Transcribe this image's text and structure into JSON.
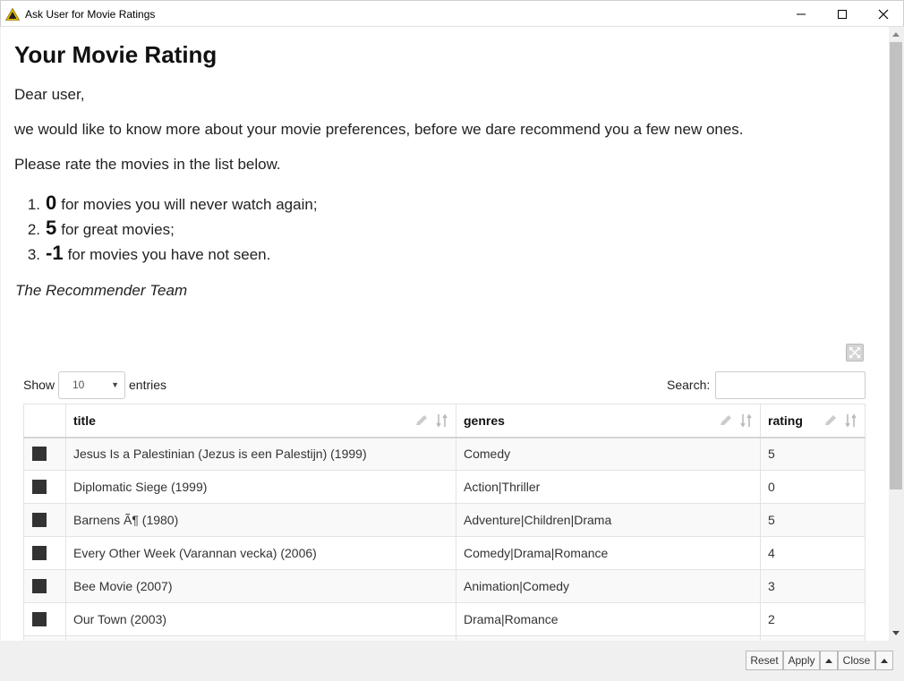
{
  "window": {
    "title": "Ask User for Movie Ratings",
    "icon": "warning-triangle-icon",
    "accent": "#e6b800"
  },
  "page": {
    "heading": "Your Movie Rating",
    "greeting": "Dear user,",
    "intro": "we would like to know more about your movie preferences, before we dare recommend you a few new ones.",
    "instruction": "Please rate the movies in the list below.",
    "rules": [
      {
        "num": "1.",
        "value": "0",
        "text": "for movies you will never watch again;"
      },
      {
        "num": "2.",
        "value": "5",
        "text": "for great movies;"
      },
      {
        "num": "3.",
        "value": "-1",
        "text": "for movies you have not seen."
      }
    ],
    "signature": "The Recommender Team"
  },
  "table_controls": {
    "show_label": "Show",
    "entries_value": "10",
    "entries_label": "entries",
    "search_label": "Search:",
    "search_value": ""
  },
  "table": {
    "headers": [
      "title",
      "genres",
      "rating"
    ],
    "rows": [
      {
        "title": "Jesus Is a Palestinian (Jezus is een Palestijn) (1999)",
        "genres": "Comedy",
        "rating": "5"
      },
      {
        "title": "Diplomatic Siege (1999)",
        "genres": "Action|Thriller",
        "rating": "0"
      },
      {
        "title": "Barnens Ã¶ (1980)",
        "genres": "Adventure|Children|Drama",
        "rating": "5"
      },
      {
        "title": "Every Other Week (Varannan vecka) (2006)",
        "genres": "Comedy|Drama|Romance",
        "rating": "4"
      },
      {
        "title": "Bee Movie (2007)",
        "genres": "Animation|Comedy",
        "rating": "3"
      },
      {
        "title": "Our Town (2003)",
        "genres": "Drama|Romance",
        "rating": "2"
      },
      {
        "title": "",
        "genres": "",
        "rating": ""
      }
    ]
  },
  "buttons": {
    "reset": "Reset",
    "apply": "Apply",
    "close": "Close"
  }
}
